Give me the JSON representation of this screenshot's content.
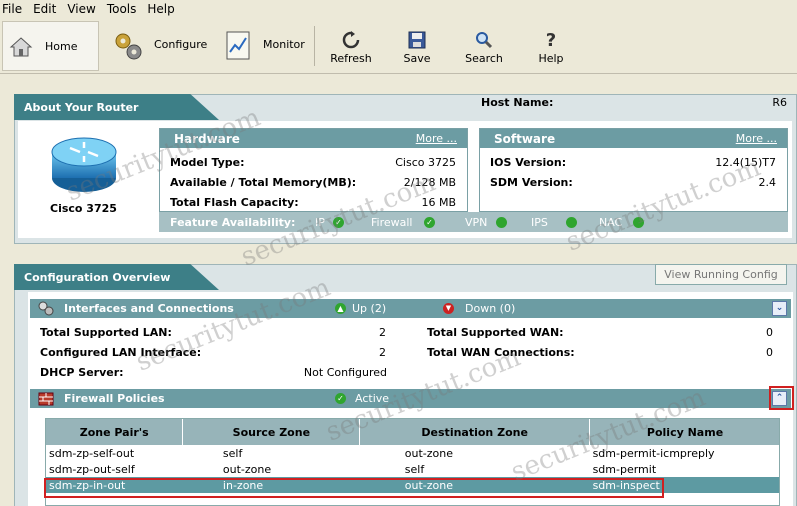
{
  "menu": [
    "File",
    "Edit",
    "View",
    "Tools",
    "Help"
  ],
  "toolbar": {
    "home": "Home",
    "configure": "Configure",
    "monitor": "Monitor",
    "refresh": "Refresh",
    "save": "Save",
    "search": "Search",
    "help": "Help"
  },
  "about": {
    "title": "About Your Router",
    "host_label": "Host Name:",
    "host_value": "R6",
    "router_name": "Cisco 3725"
  },
  "hardware": {
    "title": "Hardware",
    "more": "More ...",
    "rows": [
      {
        "label": "Model Type:",
        "value": "Cisco 3725"
      },
      {
        "label": "Available / Total Memory(MB):",
        "value": "2/128 MB"
      },
      {
        "label": "Total Flash Capacity:",
        "value": "16 MB"
      }
    ]
  },
  "software": {
    "title": "Software",
    "more": "More ...",
    "rows": [
      {
        "label": "IOS Version:",
        "value": "12.4(15)T7"
      },
      {
        "label": "SDM Version:",
        "value": "2.4"
      }
    ]
  },
  "features": {
    "label": "Feature Availability:",
    "items": [
      "IP",
      "Firewall",
      "VPN",
      "IPS",
      "NAC"
    ]
  },
  "config": {
    "title": "Configuration Overview",
    "view_running": "View Running Config"
  },
  "interfaces": {
    "title": "Interfaces and Connections",
    "up": "Up (2)",
    "down": "Down (0)",
    "rows": [
      {
        "label": "Total Supported LAN:",
        "value": "2",
        "label2": "Total Supported WAN:",
        "value2": "0"
      },
      {
        "label": "Configured LAN Interface:",
        "value": "2",
        "label2": "Total WAN Connections:",
        "value2": "0"
      },
      {
        "label": "DHCP Server:",
        "value": "Not Configured"
      }
    ]
  },
  "firewall": {
    "title": "Firewall Policies",
    "status": "Active",
    "columns": [
      "Zone Pair's",
      "Source Zone",
      "Destination Zone",
      "Policy Name"
    ],
    "rows": [
      [
        "sdm-zp-self-out",
        "self",
        "out-zone",
        "sdm-permit-icmpreply"
      ],
      [
        "sdm-zp-out-self",
        "out-zone",
        "self",
        "sdm-permit"
      ],
      [
        "sdm-zp-in-out",
        "in-zone",
        "out-zone",
        "sdm-inspect"
      ]
    ]
  },
  "watermark": "securitytut.com",
  "colors": {
    "accent": "#3d7f87",
    "section": "#6c9ca3",
    "selected": "#5d9aa2",
    "highlight": "#d02020"
  }
}
